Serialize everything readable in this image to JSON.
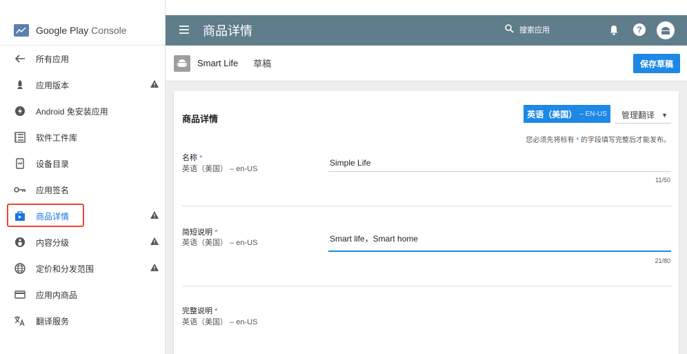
{
  "sidebar": {
    "brand_main": "Google Play",
    "brand_sub": " Console",
    "items": [
      {
        "label": "所有应用",
        "icon": "back-arrow-icon",
        "warn": false
      },
      {
        "label": "应用版本",
        "icon": "rocket-icon",
        "warn": true
      },
      {
        "label": "Android 免安装应用",
        "icon": "instant-app-icon",
        "warn": false
      },
      {
        "label": "软件工件库",
        "icon": "library-icon",
        "warn": false
      },
      {
        "label": "设备目录",
        "icon": "device-icon",
        "warn": false
      },
      {
        "label": "应用签名",
        "icon": "key-icon",
        "warn": false
      },
      {
        "label": "商品详情",
        "icon": "store-icon",
        "warn": true,
        "active": true
      },
      {
        "label": "内容分级",
        "icon": "rating-icon",
        "warn": true
      },
      {
        "label": "定价和分发范围",
        "icon": "globe-icon",
        "warn": true
      },
      {
        "label": "应用内商品",
        "icon": "card-icon",
        "warn": false
      },
      {
        "label": "翻译服务",
        "icon": "translate-icon",
        "warn": false
      }
    ]
  },
  "topbar": {
    "title": "商品详情",
    "search_label": "搜索应用"
  },
  "subbar": {
    "app_name": "Smart Life",
    "status": "草稿",
    "save_label": "保存草稿"
  },
  "card": {
    "title": "商品详情",
    "lang_main": "英语（美国）",
    "lang_code": "– EN-US",
    "manage_label": "管理翻译",
    "required_note_pre": "您必须先将标有 ",
    "required_note_star": "*",
    "required_note_post": " 的字段填写完整后才能发布。",
    "fields": [
      {
        "label": "名称",
        "sub": "英语（美国） – en-US",
        "value": "Simple Life",
        "counter": "11/50"
      },
      {
        "label": "简短说明",
        "sub": "英语（美国） – en-US",
        "value": "Smart life，Smart home",
        "counter": "21/80"
      },
      {
        "label": "完整说明",
        "sub": "英语（美国） – en-US",
        "value": "",
        "counter": ""
      }
    ]
  },
  "colors": {
    "topbar": "#607d8b",
    "accent": "#1e88e5",
    "highlight_box": "#e8472f"
  }
}
